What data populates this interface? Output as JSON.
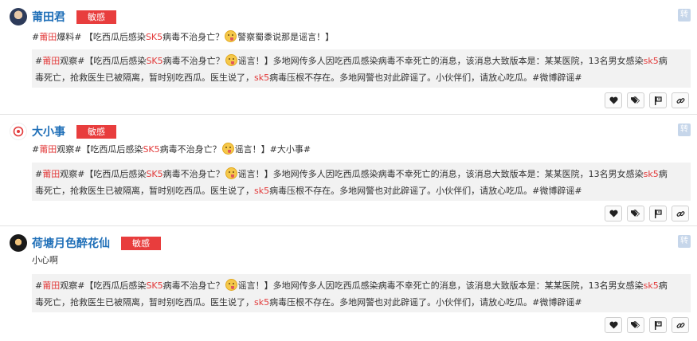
{
  "posts": [
    {
      "username": "莆田君",
      "badge": "敏感",
      "repost_label": "转",
      "text_pre": "#",
      "text_hl1": "莆田",
      "text_mid1": "爆料# 【吃西瓜后感染",
      "text_hl2": "SK5",
      "text_mid2": "病毒不治身亡？",
      "text_post": "警察蜀黍说那是谣言！】",
      "quote": {
        "p1": "#",
        "h1": "莆田",
        "p2": "观察#【吃西瓜后感染",
        "h2": "SK5",
        "p3": "病毒不治身亡？",
        "p4": "谣言！】多地网传多人因吃西瓜感染病毒不幸死亡的消息，该消息大致版本是：某某医院，13名男女感染",
        "h3": "sk5",
        "p5": "病",
        "line2a": "毒死亡，抢救医生已被隔离，暂时别吃西瓜。医生说了，",
        "h4": "sk5",
        "line2b": "病毒压根不存在。多地网警也对此辟谣了。小伙伴们，请放心吃瓜。#微博辟谣#"
      }
    },
    {
      "username": "大小事",
      "badge": "敏感",
      "repost_label": "转",
      "text_pre": "#",
      "text_hl1": "莆田",
      "text_mid1": "观察#【吃西瓜后感染",
      "text_hl2": "SK5",
      "text_mid2": "病毒不治身亡？",
      "text_post": "谣言！】#大小事#",
      "quote": {
        "p1": "#",
        "h1": "莆田",
        "p2": "观察#【吃西瓜后感染",
        "h2": "SK5",
        "p3": "病毒不治身亡？",
        "p4": "谣言！】多地网传多人因吃西瓜感染病毒不幸死亡的消息，该消息大致版本是：某某医院，13名男女感染",
        "h3": "sk5",
        "p5": "病",
        "line2a": "毒死亡，抢救医生已被隔离，暂时别吃西瓜。医生说了，",
        "h4": "sk5",
        "line2b": "病毒压根不存在。多地网警也对此辟谣了。小伙伴们，请放心吃瓜。#微博辟谣#"
      }
    },
    {
      "username": "荷塘月色醉花仙",
      "badge": "敏感",
      "repost_label": "转",
      "text_plain": "小心啊",
      "quote": {
        "p1": "#",
        "h1": "莆田",
        "p2": "观察#【吃西瓜后感染",
        "h2": "SK5",
        "p3": "病毒不治身亡？",
        "p4": "谣言！】多地网传多人因吃西瓜感染病毒不幸死亡的消息，该消息大致版本是：某某医院，13名男女感染",
        "h3": "sk5",
        "p5": "病",
        "line2a": "毒死亡，抢救医生已被隔离，暂时别吃西瓜。医生说了，",
        "h4": "sk5",
        "line2b": "病毒压根不存在。多地网警也对此辟谣了。小伙伴们，请放心吃瓜。#微博辟谣#"
      }
    }
  ],
  "icons": [
    "heart-icon",
    "tag-icon",
    "flag-icon",
    "link-icon"
  ],
  "colors": {
    "accent": "#1f6fb8",
    "highlight": "#e23a3a",
    "badge": "#e83d3d"
  }
}
